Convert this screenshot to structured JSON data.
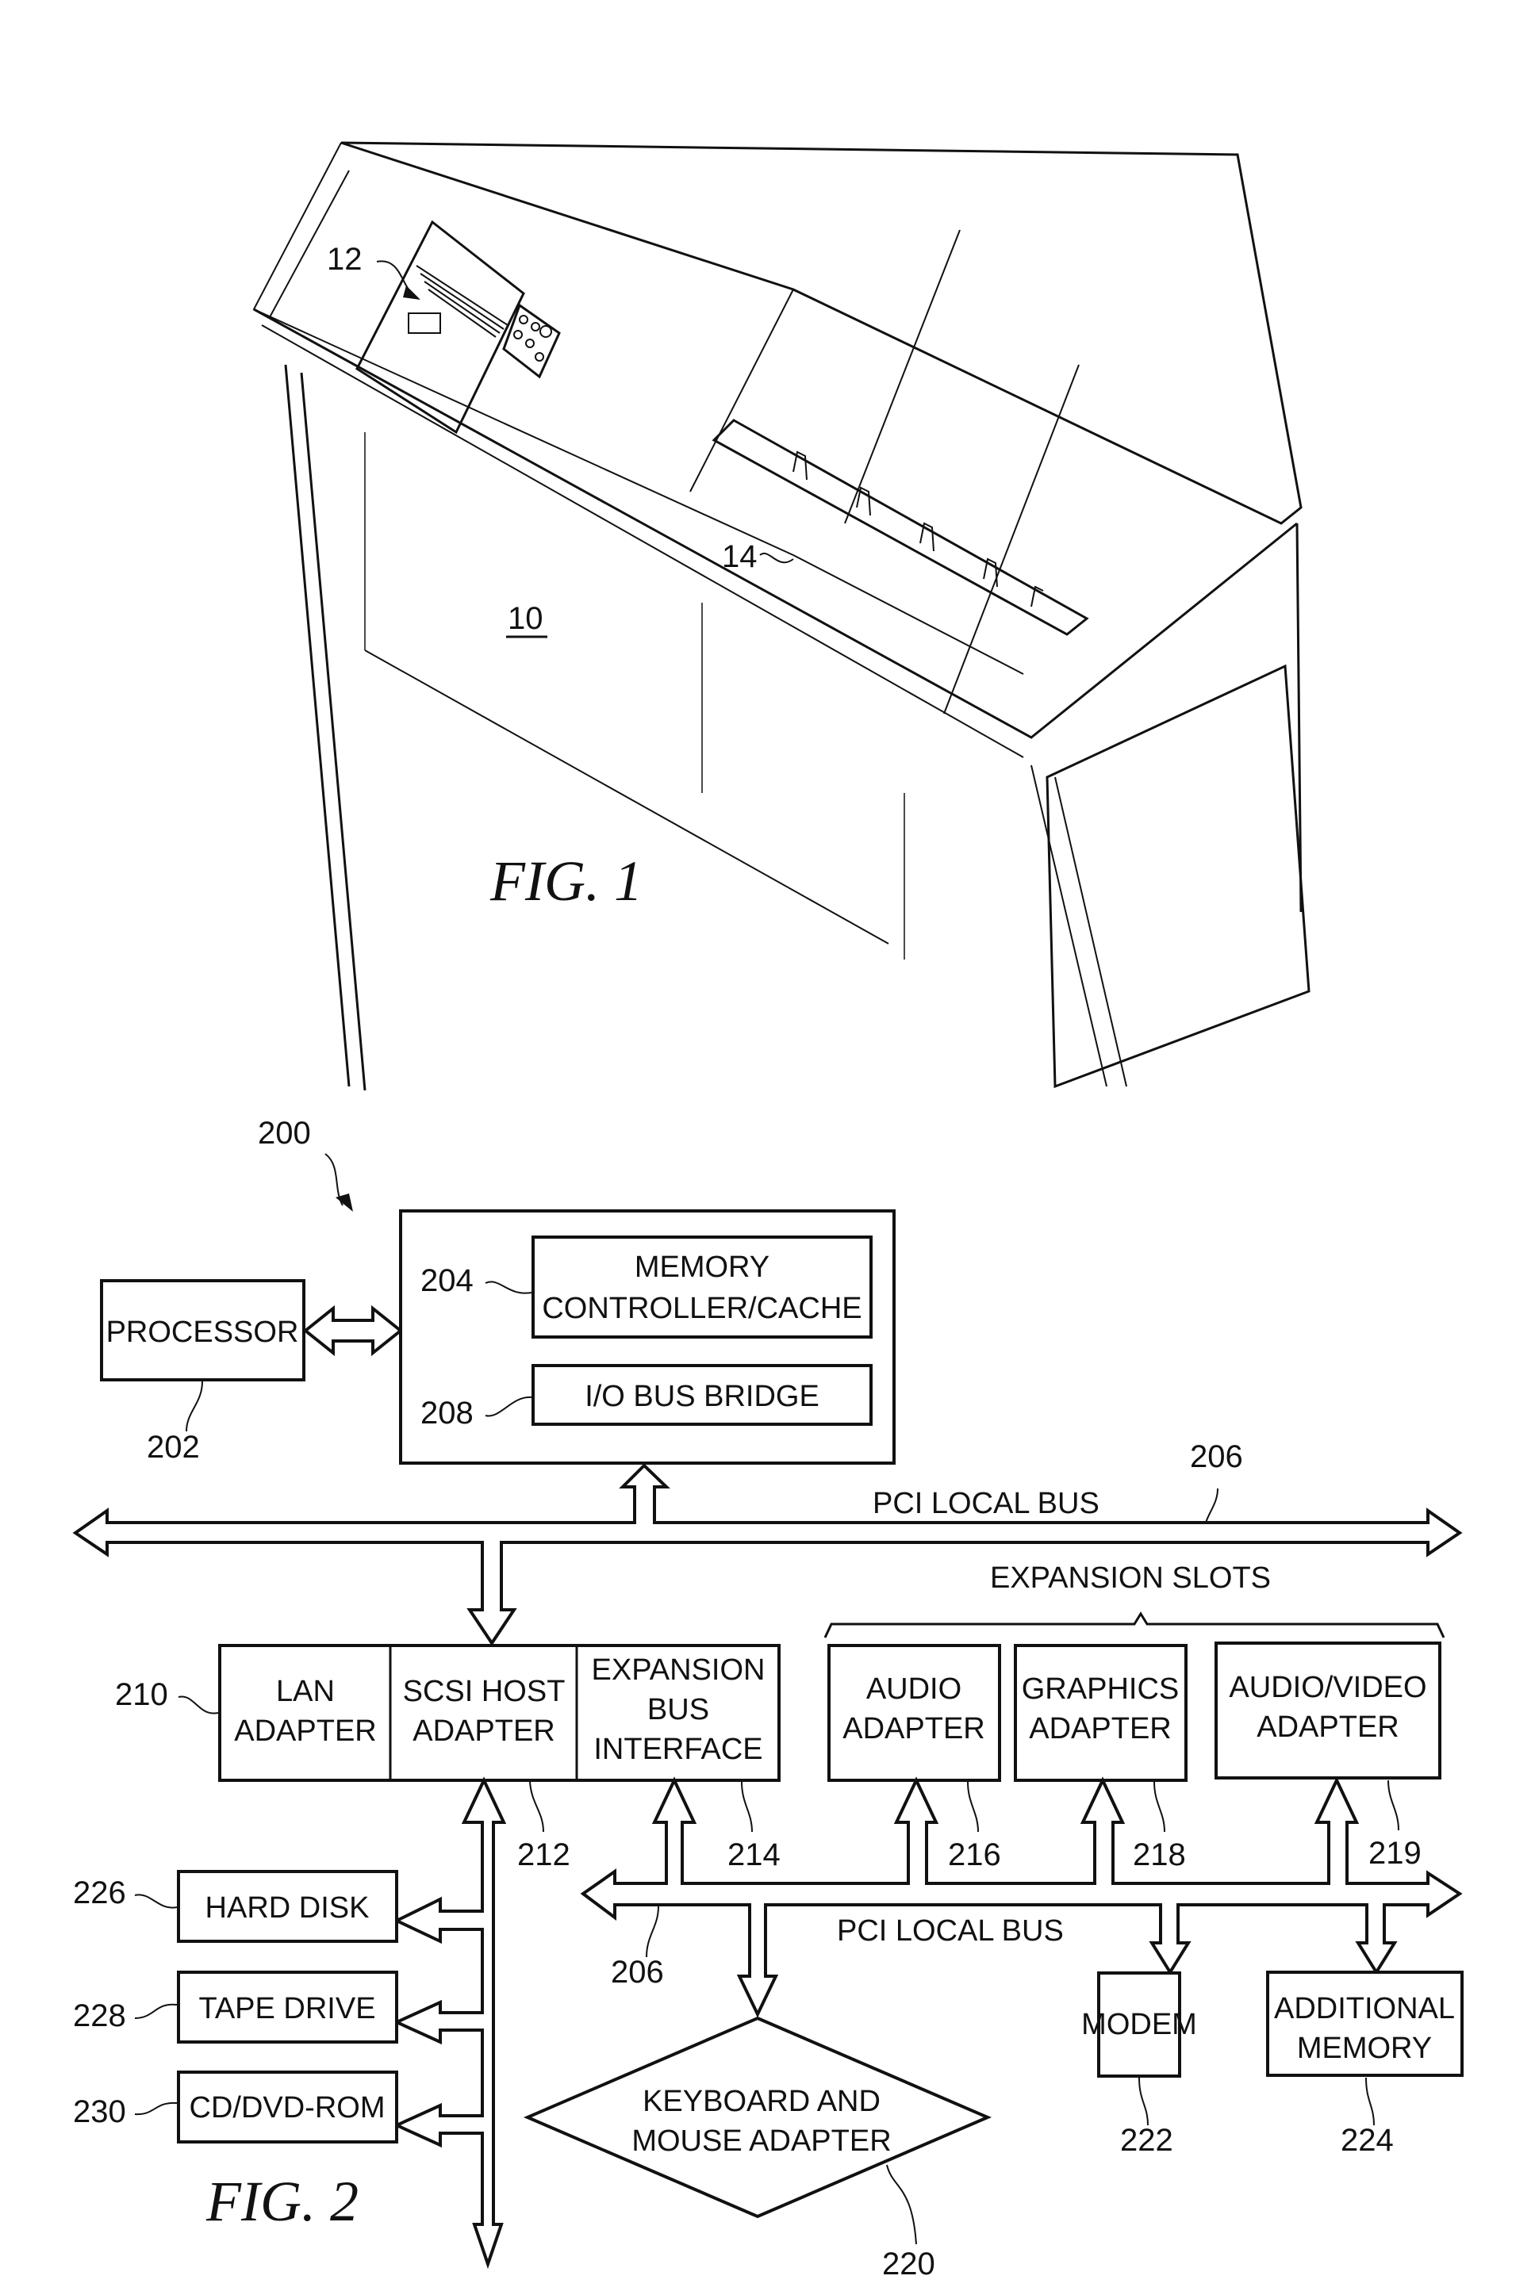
{
  "fig1": {
    "caption": "FIG. 1",
    "refs": {
      "machine": "10",
      "hopper": "12",
      "pockets": "14"
    }
  },
  "fig2": {
    "caption": "FIG. 2",
    "system_ref": "200",
    "processor": {
      "label": "PROCESSOR",
      "ref": "202"
    },
    "host_bridge": {
      "memory_controller": {
        "lines": [
          "MEMORY",
          "CONTROLLER/CACHE"
        ],
        "ref": "204"
      },
      "io_bus_bridge": {
        "label": "I/O BUS BRIDGE",
        "ref": "208"
      }
    },
    "pci_bus_upper": {
      "label": "PCI LOCAL BUS",
      "ref": "206"
    },
    "expansion_slots_label": "EXPANSION SLOTS",
    "lan_adapter": {
      "lines": [
        "LAN",
        "ADAPTER"
      ],
      "ref": "210"
    },
    "scsi_adapter": {
      "lines": [
        "SCSI HOST",
        "ADAPTER"
      ],
      "ref": "212"
    },
    "expansion_bus_interface": {
      "lines": [
        "EXPANSION",
        "BUS",
        "INTERFACE"
      ],
      "ref": "214"
    },
    "audio_adapter": {
      "lines": [
        "AUDIO",
        "ADAPTER"
      ],
      "ref": "216"
    },
    "graphics_adapter": {
      "lines": [
        "GRAPHICS",
        "ADAPTER"
      ],
      "ref": "218"
    },
    "av_adapter": {
      "lines": [
        "AUDIO/VIDEO",
        "ADAPTER"
      ],
      "ref": "219"
    },
    "pci_bus_lower": {
      "label": "PCI LOCAL BUS",
      "ref": "206"
    },
    "hard_disk": {
      "label": "HARD DISK",
      "ref": "226"
    },
    "tape_drive": {
      "label": "TAPE DRIVE",
      "ref": "228"
    },
    "cd_dvd": {
      "label": "CD/DVD-ROM",
      "ref": "230"
    },
    "keyboard_mouse": {
      "lines": [
        "KEYBOARD AND",
        "MOUSE ADAPTER"
      ],
      "ref": "220"
    },
    "modem": {
      "label": "MODEM",
      "ref": "222"
    },
    "additional_memory": {
      "lines": [
        "ADDITIONAL",
        "MEMORY"
      ],
      "ref": "224"
    }
  }
}
